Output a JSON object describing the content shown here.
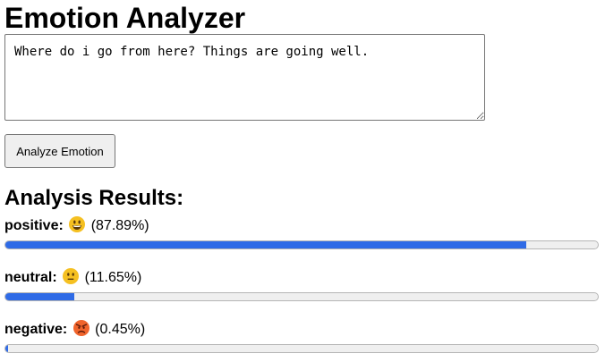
{
  "title": "Emotion Analyzer",
  "input": {
    "value": "Where do i go from here? Things are going well."
  },
  "analyze_button_label": "Analyze Emotion",
  "results_heading": "Analysis Results:",
  "results": [
    {
      "label": "positive:",
      "emoji": "grinning-face-icon",
      "percent_text": "(87.89%)",
      "fraction": 0.8789,
      "color": "#2f6be6"
    },
    {
      "label": "neutral:",
      "emoji": "neutral-face-icon",
      "percent_text": "(11.65%)",
      "fraction": 0.1165,
      "color": "#2f6be6"
    },
    {
      "label": "negative:",
      "emoji": "angry-face-icon",
      "percent_text": "(0.45%)",
      "fraction": 0.0045,
      "color": "#2f6be6"
    }
  ]
}
